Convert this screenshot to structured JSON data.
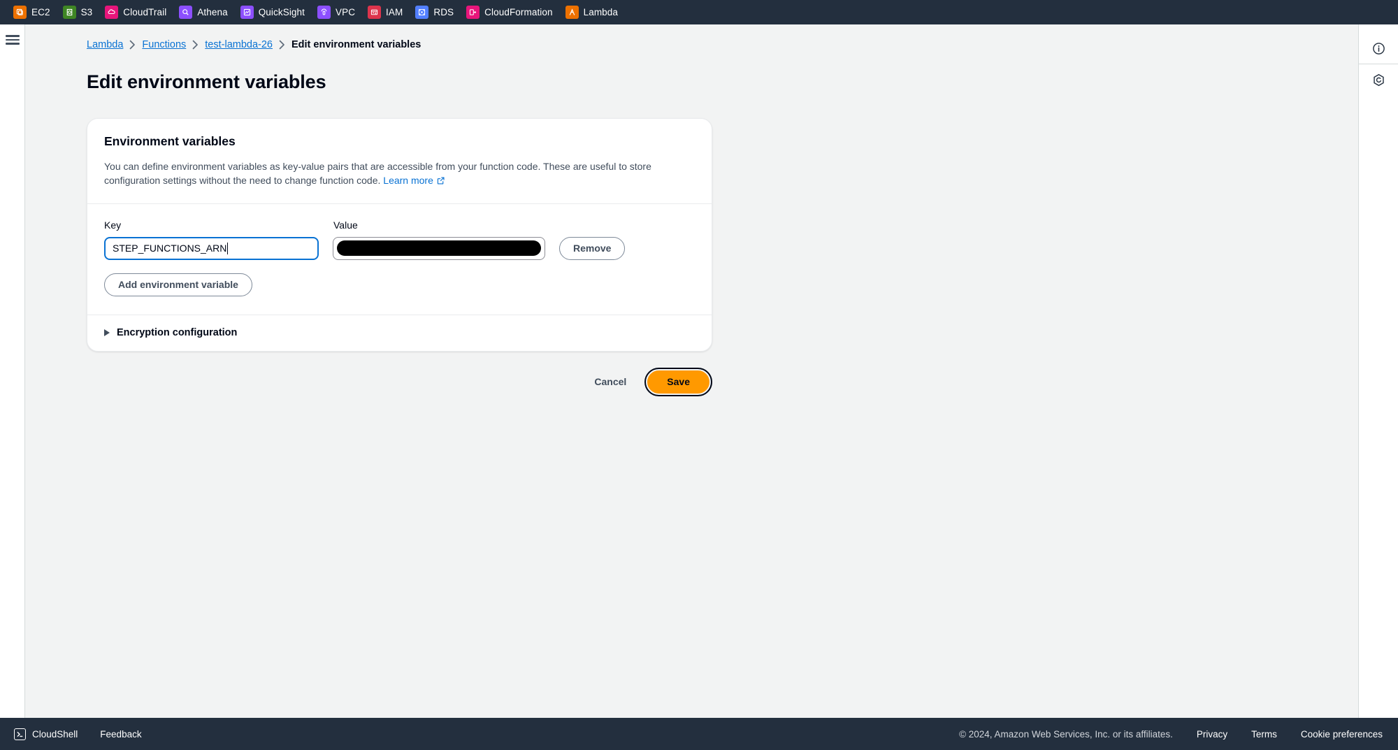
{
  "bookmarks_bar": {
    "items": [
      {
        "label": "EC2",
        "icon": "ec2-icon",
        "color": "#ed7100"
      },
      {
        "label": "S3",
        "icon": "s3-icon",
        "color": "#3f8624"
      },
      {
        "label": "CloudTrail",
        "icon": "cloudtrail-icon",
        "color": "#e7157b"
      },
      {
        "label": "Athena",
        "icon": "athena-icon",
        "color": "#8c4fff"
      },
      {
        "label": "QuickSight",
        "icon": "quicksight-icon",
        "color": "#8c4fff"
      },
      {
        "label": "VPC",
        "icon": "vpc-icon",
        "color": "#8c4fff"
      },
      {
        "label": "IAM",
        "icon": "iam-icon",
        "color": "#dd344c"
      },
      {
        "label": "RDS",
        "icon": "rds-icon",
        "color": "#527fff"
      },
      {
        "label": "CloudFormation",
        "icon": "cloudformation-icon",
        "color": "#e7157b"
      },
      {
        "label": "Lambda",
        "icon": "lambda-icon",
        "color": "#ed7100"
      }
    ]
  },
  "left_rail": {
    "menu_icon": "hamburger-icon"
  },
  "right_rail": {
    "info_icon": "info-circle-icon",
    "shield_icon": "shield-hexagon-icon"
  },
  "breadcrumb": {
    "items": [
      {
        "label": "Lambda",
        "is_link": true
      },
      {
        "label": "Functions",
        "is_link": true
      },
      {
        "label": "test-lambda-26",
        "is_link": true
      },
      {
        "label": "Edit environment variables",
        "is_link": false
      }
    ],
    "separator": "›"
  },
  "page": {
    "title": "Edit environment variables"
  },
  "card": {
    "title": "Environment variables",
    "description_part1": "You can define environment variables as key-value pairs that are accessible from your function code. These are useful to store configuration settings without the need to change function code.",
    "learn_more_label": "Learn more",
    "learn_more_icon": "external-link-icon",
    "labels": {
      "key": "Key",
      "value": "Value"
    },
    "rows": [
      {
        "key_value": "STEP_FUNCTIONS_ARN",
        "key_placeholder": "",
        "value_value": "",
        "value_redacted": true,
        "remove_label": "Remove"
      }
    ],
    "add_button_label": "Add environment variable",
    "encryption": {
      "label": "Encryption configuration",
      "expanded": false,
      "toggle_icon": "caret-right-icon"
    }
  },
  "form_actions": {
    "cancel_label": "Cancel",
    "save_label": "Save",
    "save_color": "#ff9900"
  },
  "footer": {
    "cloudshell_label": "CloudShell",
    "cloudshell_icon": "terminal-icon",
    "feedback_label": "Feedback",
    "copyright": "© 2024, Amazon Web Services, Inc. or its affiliates.",
    "links": [
      "Privacy",
      "Terms",
      "Cookie preferences"
    ]
  }
}
